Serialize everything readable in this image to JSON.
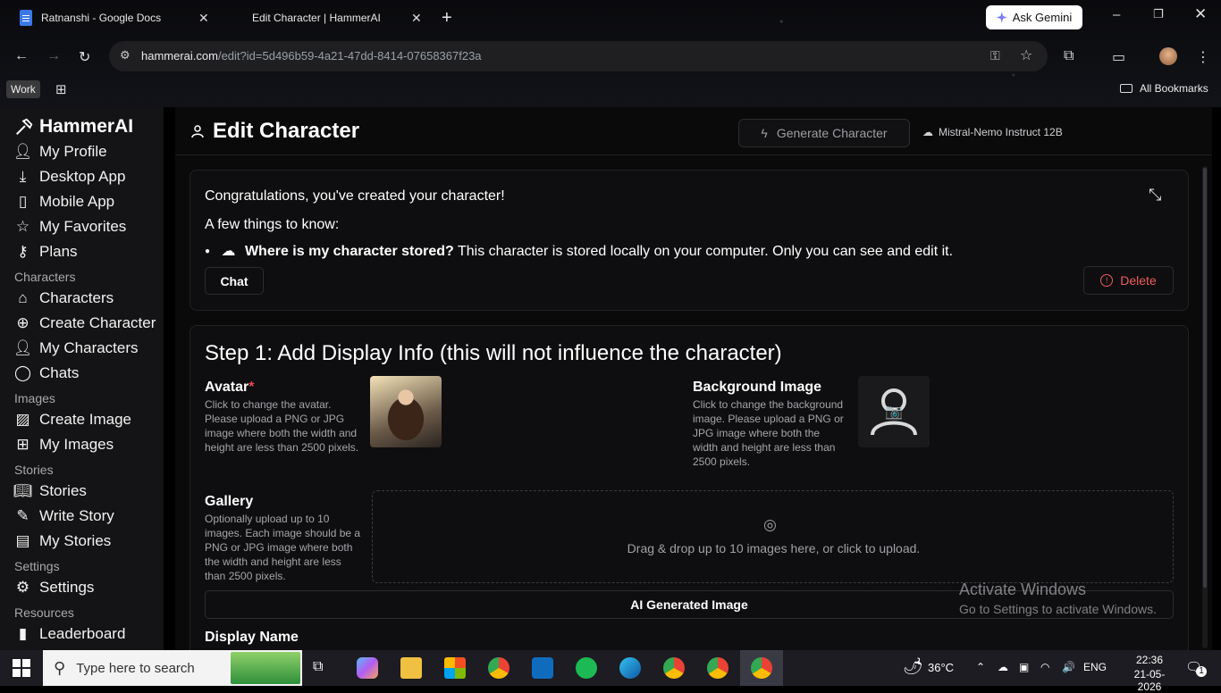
{
  "browser": {
    "tabs": [
      {
        "title": "Ratnanshi - Google Docs"
      },
      {
        "title": "Edit Character | HammerAI"
      }
    ],
    "new_tab_label": "+",
    "ask_gemini": "Ask Gemini",
    "url_host": "hammerai.com",
    "url_path": "/edit?id=5d496b59-4a21-47dd-8414-07658367f23a",
    "work_chip": "Work",
    "all_bookmarks": "All Bookmarks"
  },
  "sidebar": {
    "brand": "HammerAI",
    "items_top": [
      {
        "label": "My Profile",
        "icon": "user-icon"
      },
      {
        "label": "Desktop App",
        "icon": "download-icon"
      },
      {
        "label": "Mobile App",
        "icon": "phone-icon"
      },
      {
        "label": "My Favorites",
        "icon": "star-icon"
      },
      {
        "label": "Plans",
        "icon": "key-icon"
      }
    ],
    "sections": [
      {
        "heading": "Characters",
        "items": [
          {
            "label": "Characters",
            "icon": "home-icon"
          },
          {
            "label": "Create Character",
            "icon": "plus-circle-icon"
          },
          {
            "label": "My Characters",
            "icon": "user-icon"
          },
          {
            "label": "Chats",
            "icon": "chat-icon"
          }
        ]
      },
      {
        "heading": "Images",
        "items": [
          {
            "label": "Create Image",
            "icon": "image-icon"
          },
          {
            "label": "My Images",
            "icon": "grid-icon"
          }
        ]
      },
      {
        "heading": "Stories",
        "items": [
          {
            "label": "Stories",
            "icon": "book-open-icon"
          },
          {
            "label": "Write Story",
            "icon": "pen-icon"
          },
          {
            "label": "My Stories",
            "icon": "book-icon"
          }
        ]
      },
      {
        "heading": "Settings",
        "items": [
          {
            "label": "Settings",
            "icon": "gear-icon"
          }
        ]
      },
      {
        "heading": "Resources",
        "items": [
          {
            "label": "Leaderboard",
            "icon": "bar-chart-icon"
          }
        ]
      }
    ]
  },
  "header": {
    "title": "Edit Character",
    "generate_button": "Generate Character",
    "model": "Mistral-Nemo Instruct 12B"
  },
  "notice": {
    "congrats": "Congratulations, you've created your character!",
    "few_things": "A few things to know:",
    "storage_question": "Where is my character stored?",
    "storage_answer": " This character is stored locally on your computer. Only you can see and edit it.",
    "chat_button": "Chat",
    "delete_button": "Delete"
  },
  "step1": {
    "title": "Step 1: Add Display Info (this will not influence the character)",
    "avatar_label": "Avatar",
    "required_mark": "*",
    "avatar_desc": "Click to change the avatar. Please upload a PNG or JPG image where both the width and height are less than 2500 pixels.",
    "background_label": "Background Image",
    "background_desc": "Click to change the background image. Please upload a PNG or JPG image where both the width and height are less than 2500 pixels.",
    "gallery_label": "Gallery",
    "gallery_desc": "Optionally upload up to 10 images. Each image should be a PNG or JPG image where both the width and height are less than 2500 pixels.",
    "dropzone_text": "Drag & drop up to 10 images here, or click to upload.",
    "ai_generated_button": "AI Generated Image",
    "display_name_label": "Display Name"
  },
  "watermark": {
    "line1": "Activate Windows",
    "line2": "Go to Settings to activate Windows."
  },
  "taskbar": {
    "search_placeholder": "Type here to search",
    "temperature": "36°C",
    "language": "ENG",
    "time": "22:36",
    "date": "21-05-2026",
    "notification_count": "1"
  }
}
